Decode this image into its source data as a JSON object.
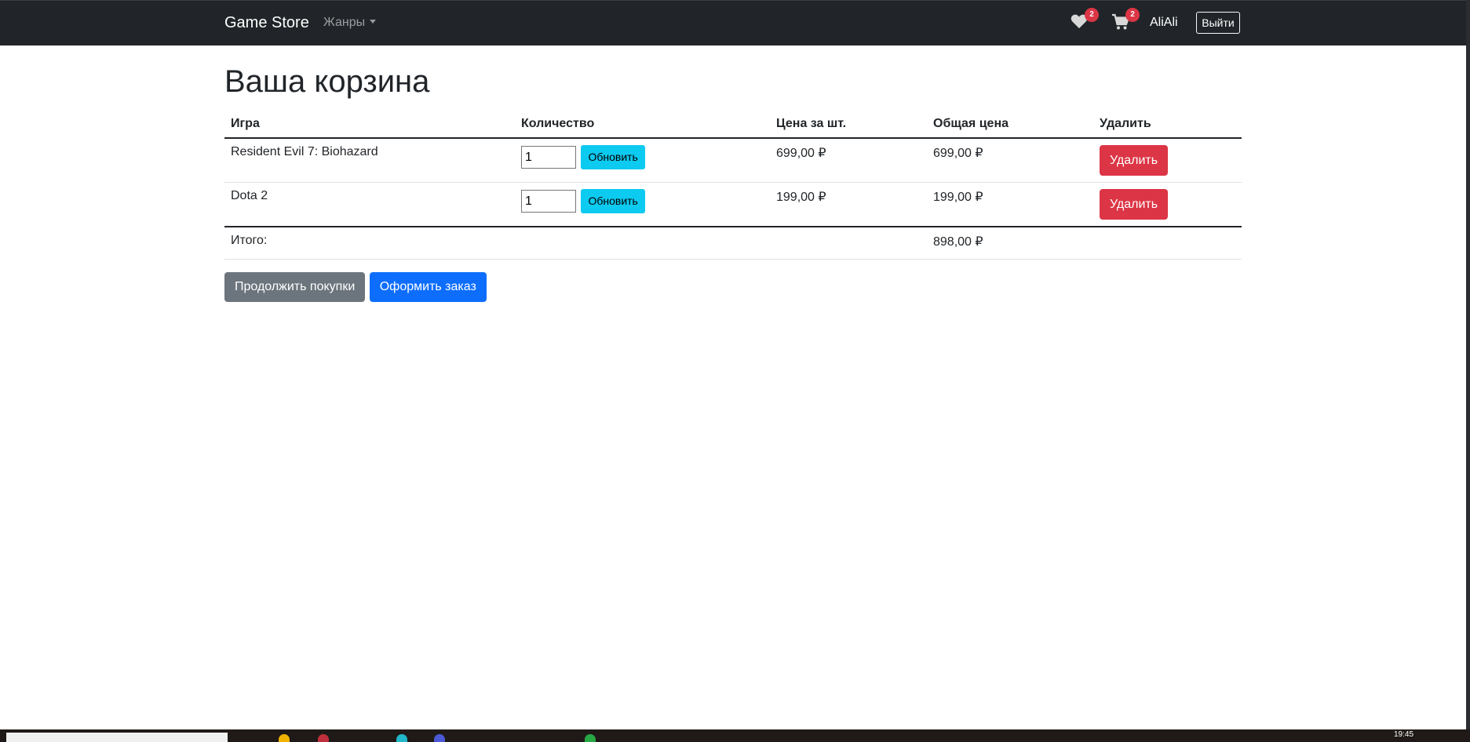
{
  "navbar": {
    "brand": "Game Store",
    "genres_label": "Жанры",
    "wishlist_count": "2",
    "cart_count": "2",
    "username": "AliAli",
    "logout_label": "Выйти"
  },
  "page_title": "Ваша корзина",
  "table": {
    "headers": [
      "Игра",
      "Количество",
      "Цена за шт.",
      "Общая цена",
      "Удалить"
    ],
    "rows": [
      {
        "game": "Resident Evil 7: Biohazard",
        "quantity": "1",
        "update_label": "Обновить",
        "unit_price": "699,00 ₽",
        "total_price": "699,00 ₽",
        "delete_label": "Удалить"
      },
      {
        "game": "Dota 2",
        "quantity": "1",
        "update_label": "Обновить",
        "unit_price": "199,00 ₽",
        "total_price": "199,00 ₽",
        "delete_label": "Удалить"
      }
    ],
    "total_label": "Итого:",
    "total_value": "898,00 ₽"
  },
  "actions": {
    "continue_label": "Продолжить покупки",
    "checkout_label": "Оформить заказ"
  },
  "taskbar": {
    "clock": "19:45"
  },
  "colors": {
    "navbar_bg": "#212529",
    "update_btn": "#0dcaf0",
    "delete_btn": "#dc3545",
    "continue_btn": "#6c757d",
    "checkout_btn": "#0d6efd",
    "badge": "#dc3545"
  }
}
